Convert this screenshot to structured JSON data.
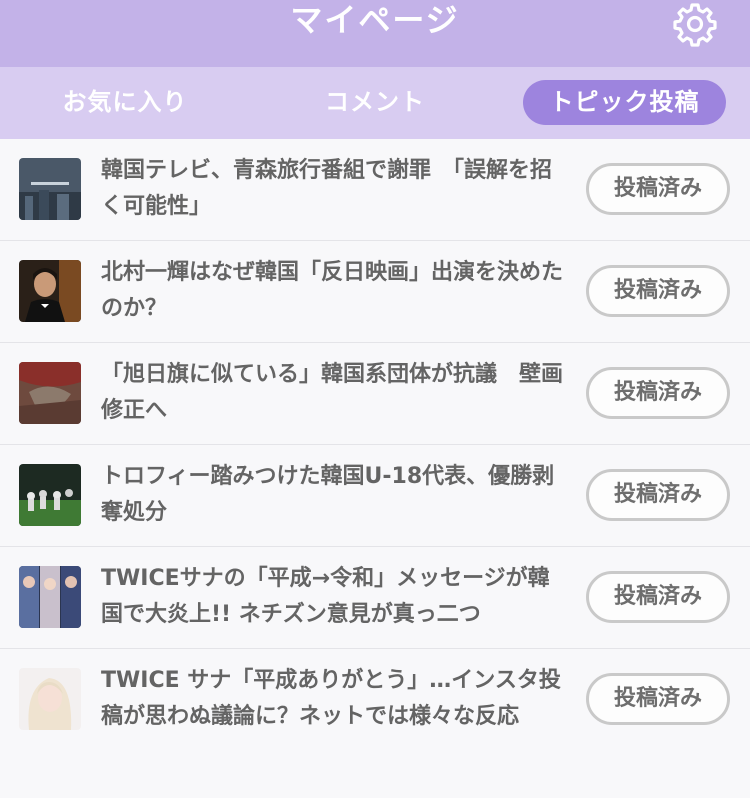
{
  "header": {
    "title": "マイページ",
    "settings_icon": "gear-icon"
  },
  "tabs": [
    {
      "label": "お気に入り",
      "active": false
    },
    {
      "label": "コメント",
      "active": false
    },
    {
      "label": "トピック投稿",
      "active": true
    }
  ],
  "colors": {
    "header_bg": "#c3b2e8",
    "tabbar_bg": "#d8ccf1",
    "active_tab_bg": "#9d84de"
  },
  "topics": [
    {
      "title": "韓国テレビ、青森旅行番組で謝罪　「誤解を招く可能性」",
      "status": "投稿済み"
    },
    {
      "title": "北村一輝はなぜ韓国「反日映画」出演を決めたのか？",
      "status": "投稿済み"
    },
    {
      "title": "「旭日旗に似ている」韓国系団体が抗議　壁画修正へ",
      "status": "投稿済み"
    },
    {
      "title": "トロフィー踏みつけた韓国U-18代表、優勝剥奪処分",
      "status": "投稿済み"
    },
    {
      "title": "TWICEサナの「平成→令和」メッセージが韓国で大炎上!! ネチズン意見が真っ二つ",
      "status": "投稿済み"
    },
    {
      "title": "TWICE サナ「平成ありがとう」…インスタ投稿が思わぬ議論に？ネットでは様々な反応",
      "status": "投稿済み"
    }
  ]
}
